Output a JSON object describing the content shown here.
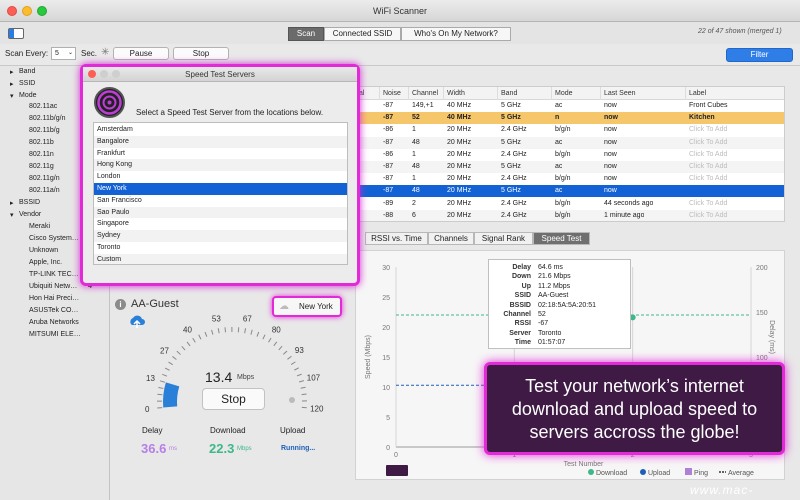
{
  "window": {
    "title": "WiFi Scanner"
  },
  "tabs": [
    {
      "label": "Scan",
      "selected": true
    },
    {
      "label": "Connected SSID",
      "selected": false
    },
    {
      "label": "Who's On My Network?",
      "selected": false
    }
  ],
  "status": {
    "shown": "22 of 47 shown (merged 1)"
  },
  "controls": {
    "scan_every_label": "Scan Every:",
    "scan_every_value": "5",
    "sec_label": "Sec.",
    "pause_label": "Pause",
    "stop_label": "Stop",
    "filter_label": "Filter"
  },
  "sidebar": {
    "groups": [
      {
        "label": "Band"
      },
      {
        "label": "SSID"
      },
      {
        "label": "Mode"
      },
      {
        "label": "BSSID"
      },
      {
        "label": "Vendor"
      }
    ],
    "modes": [
      "802.11ac",
      "802.11b/g/n",
      "802.11b/g",
      "802.11b",
      "802.11n",
      "802.11g",
      "802.11g/n",
      "802.11a/n"
    ],
    "vendors": [
      "Meraki",
      "Cisco System…",
      "Unknown",
      "Apple, Inc.",
      "TP-LINK TEC…",
      "Ubiquiti Netw…",
      "Hon Hai Preci…",
      "ASUSTek CO…",
      "Aruba Networks",
      "MITSUMI ELE…"
    ],
    "vendor_count": "4"
  },
  "table": {
    "columns": [
      "al",
      "Noise",
      "Channel",
      "Width",
      "Band",
      "Mode",
      "Last Seen",
      "Label"
    ],
    "rows": [
      {
        "noise": "-87",
        "channel": "149,+1",
        "width": "40 MHz",
        "band": "5 GHz",
        "mode": "ac",
        "last_seen": "now",
        "label": "Front Cubes",
        "style": "normal"
      },
      {
        "noise": "-87",
        "channel": "52",
        "width": "40 MHz",
        "band": "5 GHz",
        "mode": "n",
        "last_seen": "now",
        "label": "Kitchen",
        "style": "orange"
      },
      {
        "noise": "-86",
        "channel": "1",
        "width": "20 MHz",
        "band": "2.4 GHz",
        "mode": "b/g/n",
        "last_seen": "now",
        "label": "Click To Add",
        "style": "normal"
      },
      {
        "noise": "-87",
        "channel": "48",
        "width": "20 MHz",
        "band": "5 GHz",
        "mode": "ac",
        "last_seen": "now",
        "label": "Click To Add",
        "style": "normal"
      },
      {
        "noise": "-86",
        "channel": "1",
        "width": "20 MHz",
        "band": "2.4 GHz",
        "mode": "b/g/n",
        "last_seen": "now",
        "label": "Click To Add",
        "style": "normal"
      },
      {
        "noise": "-87",
        "channel": "48",
        "width": "20 MHz",
        "band": "5 GHz",
        "mode": "ac",
        "last_seen": "now",
        "label": "Click To Add",
        "style": "normal"
      },
      {
        "noise": "-87",
        "channel": "1",
        "width": "20 MHz",
        "band": "2.4 GHz",
        "mode": "b/g/n",
        "last_seen": "now",
        "label": "Click To Add",
        "style": "normal"
      },
      {
        "noise": "-87",
        "channel": "48",
        "width": "20 MHz",
        "band": "5 GHz",
        "mode": "ac",
        "last_seen": "now",
        "label": "",
        "style": "blue"
      },
      {
        "noise": "-89",
        "channel": "2",
        "width": "20 MHz",
        "band": "2.4 GHz",
        "mode": "b/g/n",
        "last_seen": "44 seconds ago",
        "label": "Click To Add",
        "style": "normal"
      },
      {
        "noise": "-88",
        "channel": "6",
        "width": "20 MHz",
        "band": "2.4 GHz",
        "mode": "b/g/n",
        "last_seen": "1 minute ago",
        "label": "Click To Add",
        "style": "normal"
      }
    ]
  },
  "bottom_tabs": [
    {
      "label": "RSSI vs. Time",
      "selected": false
    },
    {
      "label": "Channels",
      "selected": false
    },
    {
      "label": "Signal Rank",
      "selected": false
    },
    {
      "label": "Speed Test",
      "selected": true
    }
  ],
  "dialog": {
    "title": "Speed Test Servers",
    "prompt": "Select a Speed Test Server from the locations below.",
    "servers": [
      "Amsterdam",
      "Bangalore",
      "Frankfurt",
      "Hong Kong",
      "London",
      "New York",
      "San Francisco",
      "Sao Paulo",
      "Singapore",
      "Sydney",
      "Toronto",
      "Custom"
    ],
    "selected": "New York"
  },
  "speedtest": {
    "network": "AA-Guest",
    "server_button": "New York",
    "gauge_labels": [
      "0",
      "13",
      "27",
      "40",
      "53",
      "67",
      "80",
      "93",
      "107",
      "120"
    ],
    "gauge_value": "13.4",
    "gauge_unit": "Mbps",
    "gauge_fill_mbps": 13.4,
    "stop_label": "Stop",
    "delay_label": "Delay",
    "delay_value": "36.6",
    "delay_unit": "ms",
    "download_label": "Download",
    "download_value": "22.3",
    "download_unit": "Mbps",
    "upload_label": "Upload",
    "upload_value": "Running..."
  },
  "tooltip": {
    "rows": [
      {
        "k": "Delay",
        "v": "64.6 ms"
      },
      {
        "k": "Down",
        "v": "21.6 Mbps"
      },
      {
        "k": "Up",
        "v": "11.2 Mbps"
      },
      {
        "k": "SSID",
        "v": "AA-Guest"
      },
      {
        "k": "BSSID",
        "v": "02:18:5A:5A:20:51"
      },
      {
        "k": "Channel",
        "v": "52"
      },
      {
        "k": "RSSI",
        "v": "-67"
      },
      {
        "k": "Server",
        "v": "Toronto"
      },
      {
        "k": "Time",
        "v": "01:57:07"
      }
    ]
  },
  "chart_data": {
    "type": "line",
    "xlabel": "Test Number",
    "ylabel": "Speed (Mbps)",
    "y2label": "Delay (ms)",
    "yticks": [
      "0",
      "5",
      "10",
      "15",
      "20",
      "25",
      "30"
    ],
    "y2ticks": [
      "0",
      "50",
      "100",
      "150",
      "200"
    ],
    "xticks": [
      "0",
      "1",
      "2",
      "3"
    ],
    "ylim": [
      0,
      30
    ],
    "y2lim": [
      0,
      200
    ],
    "series": [
      {
        "name": "Download",
        "x": [
          1,
          2
        ],
        "y": [
          22,
          21.6
        ],
        "color": "#3db88a"
      },
      {
        "name": "Upload",
        "x": [
          1,
          2
        ],
        "y": [
          9.5,
          11.2
        ],
        "color": "#1f5fb8"
      },
      {
        "name": "Ping",
        "x": [
          1,
          2
        ],
        "y": [
          12.8,
          10.3
        ],
        "color": "#b07fd6"
      }
    ],
    "average_download": 22,
    "average_upload": 10.3,
    "legend": [
      "Download",
      "Upload",
      "Ping",
      "Average"
    ]
  },
  "promo": {
    "line1": "Test your network’s internet",
    "line2": "download and upload speed to",
    "line3": "servers accross the globe!"
  },
  "watermark": "www.mac-gm.com",
  "colors": {
    "accent": "#e22ad9",
    "selection": "#1262d6",
    "highlight": "#f6c66b",
    "download": "#3db88a",
    "upload": "#1f5fb8"
  }
}
